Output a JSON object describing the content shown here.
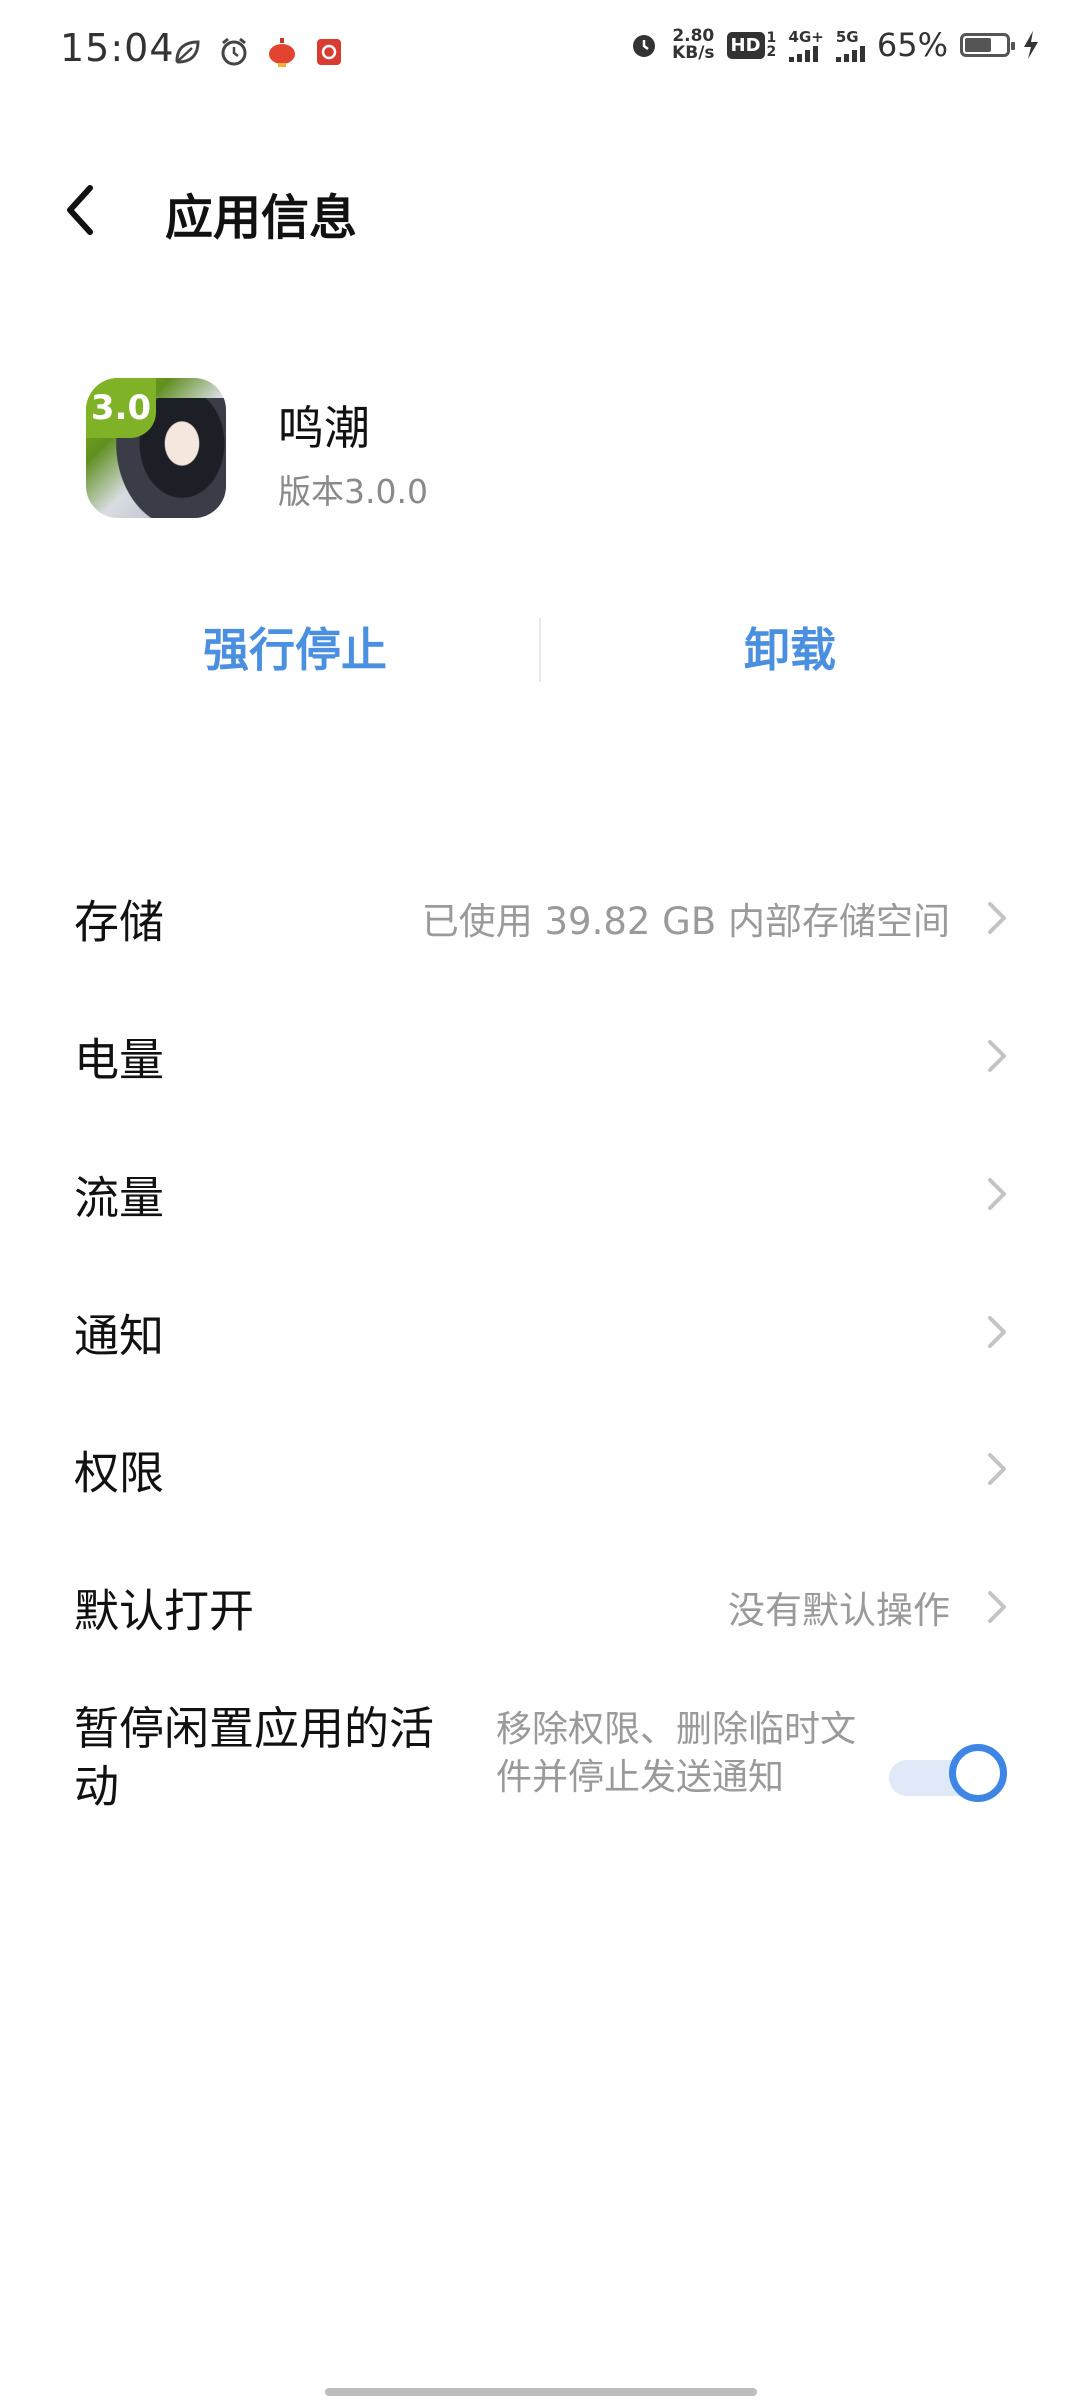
{
  "status_bar": {
    "time": "15:04",
    "net_speed_value": "2.80",
    "net_speed_unit": "KB/s",
    "hd_label": "HD",
    "hd_sub": "1 2",
    "network_1": "4G+",
    "network_2": "5G",
    "battery_percent": "65%",
    "battery_level": 0.65,
    "icons": [
      "leaf-icon",
      "alarm-icon",
      "red-lantern-icon",
      "red-envelope-icon",
      "alarm-icon",
      "charging-icon"
    ]
  },
  "header": {
    "title": "应用信息"
  },
  "app": {
    "name": "鸣潮",
    "version": "版本3.0.0",
    "icon_badge": "3.0"
  },
  "actions": {
    "force_stop": "强行停止",
    "uninstall": "卸载"
  },
  "rows": [
    {
      "label": "存储",
      "value": "已使用 39.82 GB 内部存储空间"
    },
    {
      "label": "电量",
      "value": ""
    },
    {
      "label": "流量",
      "value": ""
    },
    {
      "label": "通知",
      "value": ""
    },
    {
      "label": "权限",
      "value": ""
    },
    {
      "label": "默认打开",
      "value": "没有默认操作"
    }
  ],
  "pause_row": {
    "label": "暂停闲置应用的活动",
    "description": "移除权限、删除临时文件并停止发送通知",
    "enabled": true
  },
  "colors": {
    "accent": "#4a8fe0",
    "toggle_on": "#3d86e6",
    "secondary_text": "#9a9a9a"
  }
}
